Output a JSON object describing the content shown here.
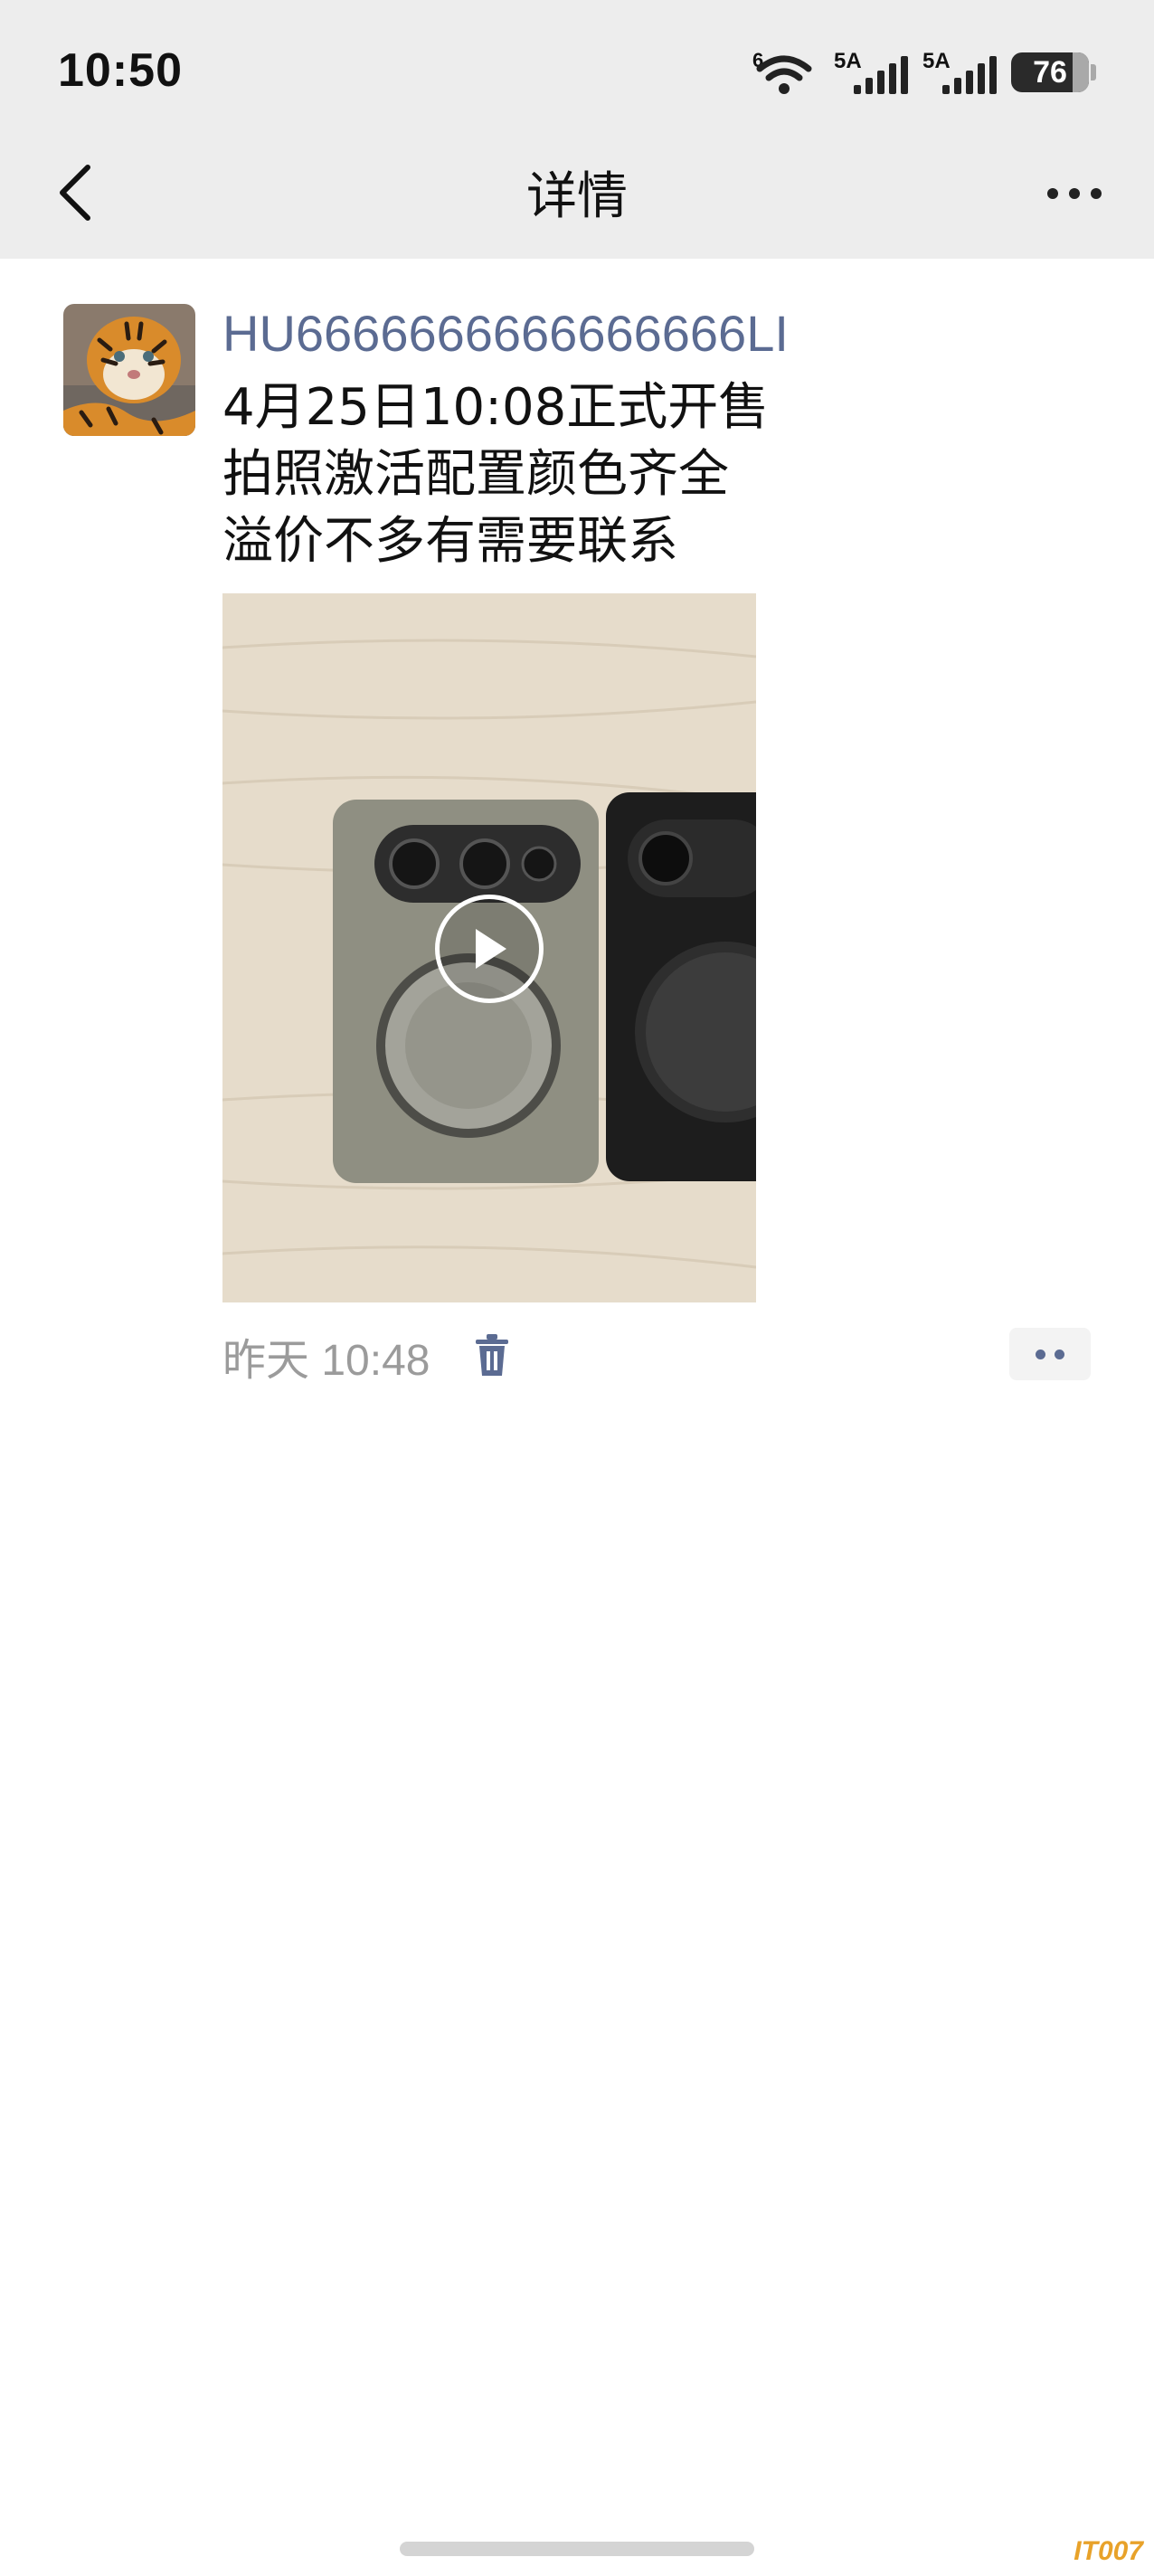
{
  "status_bar": {
    "time": "10:50",
    "wifi_label": "6",
    "signal1_label": "5A",
    "signal2_label": "5A",
    "battery_percent": "76",
    "battery_level": 0.76
  },
  "nav": {
    "title": "详情",
    "back_icon": "chevron-left-icon",
    "more_icon": "more-horizontal-icon"
  },
  "post": {
    "username": "HU6666666666666666LI",
    "text_lines": [
      "4月25日10:08正式开售",
      "拍照激活配置颜色齐全",
      "溢价不多有需要联系"
    ],
    "media_type": "video",
    "time_day": "昨天",
    "time_clock": "10:48",
    "delete_icon": "trash-icon",
    "more_icon": "more-dots-icon"
  },
  "colors": {
    "topbar_bg": "#ededed",
    "username": "#5b6b92",
    "meta_text": "#9b9b9b",
    "watermark": "#e8a22a"
  },
  "watermark": "IT007"
}
